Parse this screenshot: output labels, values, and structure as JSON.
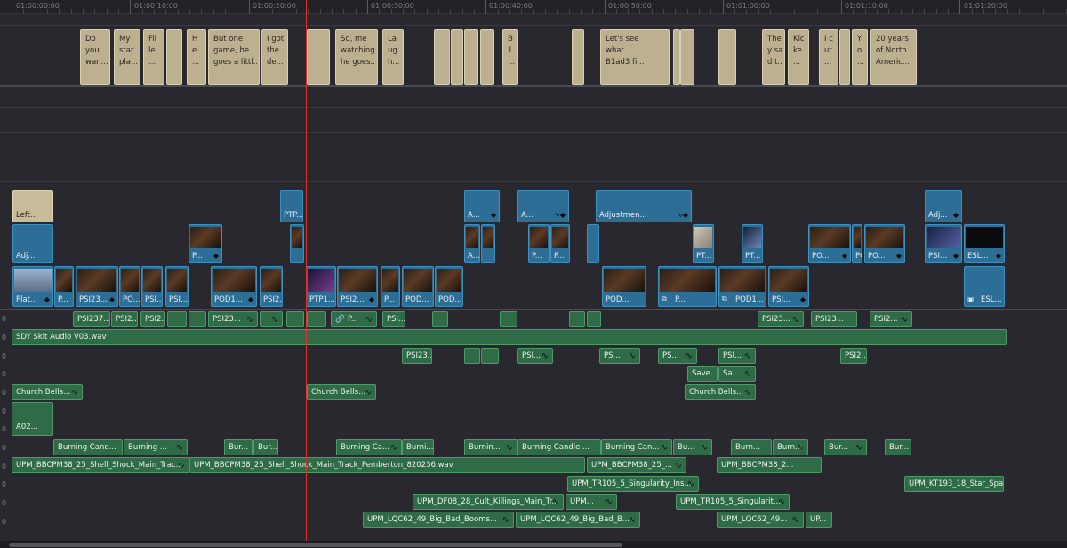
{
  "ruler": {
    "timecodes": [
      "01:00:00:00",
      "01:00:10:00",
      "01:00:20:00",
      "01:00:30:00",
      "01:00:40:00",
      "01:00:50:00",
      "01:01:00:00",
      "01:01:10:00",
      "01:01:20:00"
    ]
  },
  "subtitles": [
    "Do\nyou\nwan...",
    "My\nstar\npla...",
    "Fil\nle\n...",
    "",
    "H\ne\n...",
    "But one\ngame, he\ngoes a littl...",
    "I got\nthe\nde...",
    "",
    "So, me\nwatching,\nhe goes...",
    "La\nug\nh...",
    "",
    "",
    "",
    "",
    "B\n1\n...",
    "",
    "Let's see\nwhat\nB1ad3 fi...",
    "",
    "",
    "",
    "The\ny sai\nd t...",
    "Kic\nke\n...",
    "I c\nut\n...",
    "",
    "Y\no\n...",
    "20 years\nof North\nAmeric..."
  ],
  "video_v4": [
    {
      "label": "Left..."
    },
    {
      "label": "PTP..."
    },
    {
      "label": "A..."
    },
    {
      "label": "A..."
    },
    {
      "label": "Adjustmen..."
    },
    {
      "label": "Adj..."
    }
  ],
  "video_v3": [
    {
      "label": "Adj..."
    },
    {
      "label": "P..."
    },
    {
      "label": ""
    },
    {
      "label": "A..."
    },
    {
      "label": ""
    },
    {
      "label": "P..."
    },
    {
      "label": "P..."
    },
    {
      "label": ""
    },
    {
      "label": "PT..."
    },
    {
      "label": "PT..."
    },
    {
      "label": "PO..."
    },
    {
      "label": "PO..."
    },
    {
      "label": "PO..."
    },
    {
      "label": "PSI..."
    },
    {
      "label": "ESL..."
    }
  ],
  "video_v2": [
    {
      "label": "Plat..."
    },
    {
      "label": "P..."
    },
    {
      "label": "PSI23..."
    },
    {
      "label": "PO..."
    },
    {
      "label": "PSI..."
    },
    {
      "label": "PSI..."
    },
    {
      "label": "POD1..."
    },
    {
      "label": "PSI2..."
    },
    {
      "label": "PTP1..."
    },
    {
      "label": "PSI2..."
    },
    {
      "label": "P..."
    },
    {
      "label": "POD..."
    },
    {
      "label": "POD..."
    },
    {
      "label": "POD..."
    },
    {
      "label": "P..."
    },
    {
      "label": "POD1..."
    },
    {
      "label": "PSI..."
    },
    {
      "label": "ESL..."
    }
  ],
  "audio": {
    "a1": [
      "PSI237...",
      "PSI2...",
      "PSI2...",
      "PSI23...",
      "P...",
      "PSI...",
      "PSI23...",
      "PSI23...",
      "PSI2..."
    ],
    "a2_main": "SDY Skit Audio V03.wav",
    "a3": [
      "PSI23...",
      "PSI...",
      "PS...",
      "PS...",
      "PSI...",
      "PSI2..."
    ],
    "a4": [
      "Save...",
      "Sa..."
    ],
    "a5": [
      "Church Bells...",
      "Church Bells...",
      "Church Bells..."
    ],
    "a6": [
      "A02..."
    ],
    "a7": [
      "Burning Cand...",
      "Burning ...",
      "Bur...",
      "Bur...",
      "Burning Ca...",
      "Burni...",
      "Burnin...",
      "Burning Candle ...",
      "Burning Can...",
      "Bu...",
      "Burn...",
      "Burn...",
      "Bur...",
      "Bur..."
    ],
    "a8": [
      "UPM_BBCPM38_25_Shell_Shock_Main_Trac...",
      "UPM_BBCPM38_25_Shell_Shock_Main_Track_Pemberton_820236.wav",
      "UPM_BBCPM38_25_...",
      "UPM_BBCPM38_2..."
    ],
    "a9": [
      "UPM_TR105_5_Singularity_Ins...",
      "UPM_KT193_18_Star_Spa..."
    ],
    "a10": [
      "UPM_DF08_28_Cult_Killings_Main_Tr...",
      "UPM...",
      "UPM_TR105_5_Singularit..."
    ],
    "a11": [
      "UPM_LQC62_49_Big_Bad_Booms...",
      "UPM_LQC62_49_Big_Bad_B...",
      "UPM_LQC62_49...",
      "UP..."
    ]
  },
  "track_number": "0",
  "colors": {
    "background": "#28282e",
    "video_clip": "#2d6e96",
    "audio_clip": "#2f6b47",
    "subtitle_clip": "#bcb091",
    "playhead": "#e0302a"
  }
}
